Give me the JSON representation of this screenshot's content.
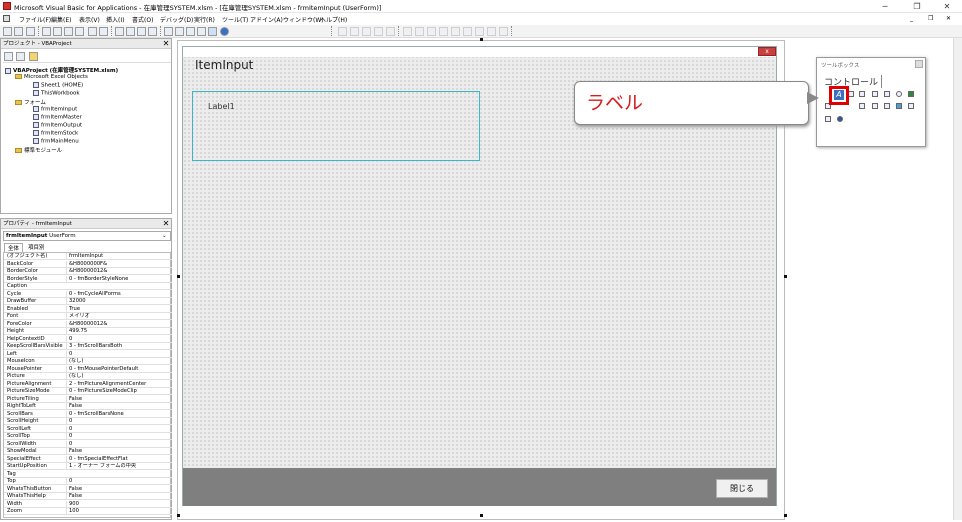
{
  "window": {
    "title": "Microsoft Visual Basic for Applications - 在庫管理SYSTEM.xlsm - [在庫管理SYSTEM.xlsm - frmItemInput (UserForm)]",
    "minimize": "─",
    "restore": "❐",
    "close": "✕"
  },
  "menu": [
    "ファイル(F)",
    "編集(E)",
    "表示(V)",
    "挿入(I)",
    "書式(O)",
    "デバッグ(D)",
    "実行(R)",
    "ツール(T)",
    "アドイン(A)",
    "ウィンドウ(W)",
    "ヘルプ(H)"
  ],
  "menu_right": {
    "min": "_",
    "restore": "❐",
    "close": "✕"
  },
  "project": {
    "title": "プロジェクト - VBAProject",
    "close": "✕",
    "root": "VBAProject (在庫管理SYSTEM.xlsm)",
    "excel_objects": "Microsoft Excel Objects",
    "sheet1": "Sheet1 (HOME)",
    "thisworkbook": "ThisWorkbook",
    "forms": "フォーム",
    "form_items": [
      "frmItemInput",
      "frmItemMaster",
      "frmItemOutput",
      "frmItemStock",
      "frmMainMenu"
    ],
    "modules": "標準モジュール"
  },
  "properties": {
    "title": "プロパティ - frmItemInput",
    "close": "✕",
    "object_name": "frmItemInput",
    "object_type": "UserForm",
    "tab_all": "全体",
    "tab_category": "項目別",
    "rows": [
      [
        "(オブジェクト名)",
        "frmItemInput"
      ],
      [
        "BackColor",
        "&H8000000F&"
      ],
      [
        "BorderColor",
        "&H80000012&"
      ],
      [
        "BorderStyle",
        "0 - fmBorderStyleNone"
      ],
      [
        "Caption",
        ""
      ],
      [
        "Cycle",
        "0 - fmCycleAllForms"
      ],
      [
        "DrawBuffer",
        "32000"
      ],
      [
        "Enabled",
        "True"
      ],
      [
        "Font",
        "メイリオ"
      ],
      [
        "ForeColor",
        "&H80000012&"
      ],
      [
        "Height",
        "499.75"
      ],
      [
        "HelpContextID",
        "0"
      ],
      [
        "KeepScrollBarsVisible",
        "3 - fmScrollBarsBoth"
      ],
      [
        "Left",
        "0"
      ],
      [
        "MouseIcon",
        "(なし)"
      ],
      [
        "MousePointer",
        "0 - fmMousePointerDefault"
      ],
      [
        "Picture",
        "(なし)"
      ],
      [
        "PictureAlignment",
        "2 - fmPictureAlignmentCenter"
      ],
      [
        "PictureSizeMode",
        "0 - fmPictureSizeModeClip"
      ],
      [
        "PictureTiling",
        "False"
      ],
      [
        "RightToLeft",
        "False"
      ],
      [
        "ScrollBars",
        "0 - fmScrollBarsNone"
      ],
      [
        "ScrollHeight",
        "0"
      ],
      [
        "ScrollLeft",
        "0"
      ],
      [
        "ScrollTop",
        "0"
      ],
      [
        "ScrollWidth",
        "0"
      ],
      [
        "ShowModal",
        "False"
      ],
      [
        "SpecialEffect",
        "0 - fmSpecialEffectFlat"
      ],
      [
        "StartUpPosition",
        "1 - オーナー フォームの中央"
      ],
      [
        "Tag",
        ""
      ],
      [
        "Top",
        "0"
      ],
      [
        "WhatsThisButton",
        "False"
      ],
      [
        "WhatsThisHelp",
        "False"
      ],
      [
        "Width",
        "900"
      ],
      [
        "Zoom",
        "100"
      ]
    ]
  },
  "form": {
    "caption": "ItemInput",
    "close_x": "x",
    "label1": "Label1",
    "close_button": "閉じる"
  },
  "toolbox": {
    "title": "ツールボックス",
    "tab": "コントロール"
  },
  "callout": {
    "text": "ラベル"
  },
  "colors": {
    "highlight": "#e00000",
    "callout_text": "#d81b1b",
    "frame_border": "#3ab8c8",
    "footer": "#7f7f7f"
  }
}
